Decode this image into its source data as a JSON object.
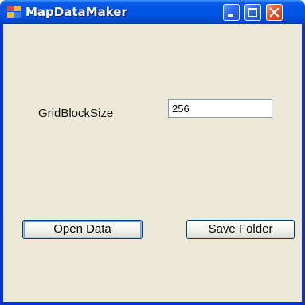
{
  "window": {
    "title": "MapDataMaker",
    "controls": {
      "minimize": "minimize-icon",
      "maximize": "maximize-icon",
      "close": "close-icon"
    }
  },
  "form": {
    "grid_block_size_label": "GridBlockSize",
    "grid_block_size_value": "256",
    "open_data_label": "Open Data",
    "save_folder_label": "Save Folder"
  },
  "colors": {
    "titlebar": "#0054e3",
    "client_background": "#ece9d8",
    "close_button": "#e0542d"
  }
}
